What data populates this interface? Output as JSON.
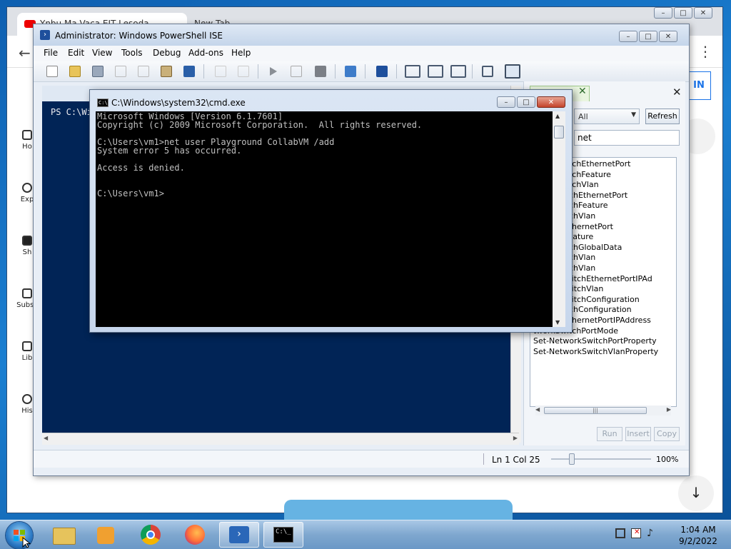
{
  "browser": {
    "tab_title": "Ynbu Ma Vaca EIT Lesoda",
    "tab2_title": "New Tab",
    "login_label": "IN",
    "sidebar": [
      {
        "label": "Ho"
      },
      {
        "label": "Exp"
      },
      {
        "label": "Sh"
      },
      {
        "label": "Subsc"
      },
      {
        "label": "Lib"
      },
      {
        "label": "His"
      }
    ]
  },
  "ise": {
    "title": "Administrator: Windows PowerShell ISE",
    "menu": [
      "File",
      "Edit",
      "View",
      "Tools",
      "Debug",
      "Add-ons",
      "Help"
    ],
    "console_prompt": "PS C:\\Wi",
    "commands_panel": {
      "module_value": "All",
      "refresh_label": "Refresh",
      "name_value": "net",
      "items": [
        "tworkSwitchEthernetPort",
        "tworkSwitchFeature",
        "tworkSwitchVlan",
        "workSwitchEthernetPort",
        "workSwitchFeature",
        "workSwitchVlan",
        "kSwitchEthernetPort",
        "kSwitchFeature",
        "workSwitchGlobalData",
        "workSwitchVlan",
        "workSwitchVlan",
        "etworkSwitchEthernetPortIPAd",
        "etworkSwitchVlan",
        "etworkSwitchConfiguration",
        "workSwitchConfiguration",
        "kSwitchEthernetPortIPAddress",
        "tworkSwitchPortMode",
        "Set-NetworkSwitchPortProperty",
        "Set-NetworkSwitchVlanProperty"
      ],
      "run_label": "Run",
      "insert_label": "Insert",
      "copy_label": "Copy"
    },
    "status": {
      "position": "Ln 1  Col 25",
      "zoom": "100%"
    }
  },
  "cmd": {
    "title": "C:\\Windows\\system32\\cmd.exe",
    "lines": [
      "Microsoft Windows [Version 6.1.7601]",
      "Copyright (c) 2009 Microsoft Corporation.  All rights reserved.",
      "",
      "C:\\Users\\vm1>net user Playground CollabVM /add",
      "System error 5 has occurred.",
      "",
      "Access is denied.",
      "",
      "",
      "C:\\Users\\vm1>"
    ]
  },
  "taskbar": {
    "time": "1:04 AM",
    "date": "9/2/2022"
  },
  "colors": {
    "ise_console_bg": "#012456",
    "cmd_bg": "#000000",
    "cmd_fg": "#c0c0c0"
  }
}
